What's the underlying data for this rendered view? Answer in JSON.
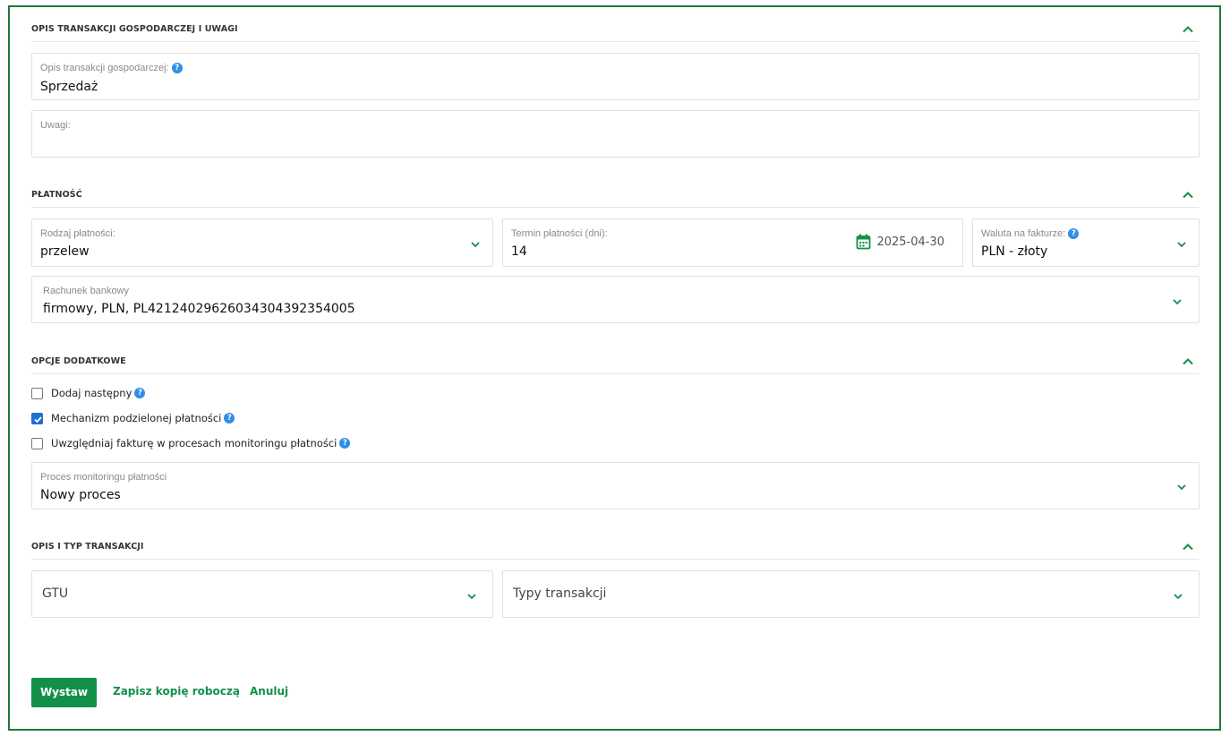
{
  "sections": {
    "transaction": {
      "title": "OPIS TRANSAKCJI GOSPODARCZEJ I UWAGI"
    },
    "payment": {
      "title": "PŁATNOŚĆ"
    },
    "options": {
      "title": "OPCJE DODATKOWE"
    },
    "type": {
      "title": "OPIS I TYP TRANSAKCJI"
    }
  },
  "fields": {
    "description": {
      "label": "Opis transakcji gospodarczej:",
      "value": "Sprzedaż"
    },
    "notes": {
      "label": "Uwagi:",
      "value": ""
    },
    "payment_type": {
      "label": "Rodzaj płatności:",
      "value": "przelew"
    },
    "payment_term": {
      "label": "Termin płatności (dni):",
      "value": "14",
      "date": "2025-04-30"
    },
    "currency": {
      "label": "Waluta na fakturze:",
      "value": "PLN - złoty"
    },
    "bank_account": {
      "label": "Rachunek bankowy",
      "value": "firmowy, PLN, PL42124029626034304392354005"
    },
    "monitoring_process": {
      "label": "Proces monitoringu płatności",
      "value": "Nowy proces"
    },
    "gtu": {
      "value": "GTU"
    },
    "transaction_types": {
      "value": "Typy transakcji"
    }
  },
  "options": [
    {
      "label": "Dodaj następny",
      "checked": false
    },
    {
      "label": "Mechanizm podzielonej płatności",
      "checked": true
    },
    {
      "label": "Uwzględniaj fakturę w procesach monitoringu płatności",
      "checked": false
    }
  ],
  "actions": {
    "issue": "Wystaw",
    "save_draft": "Zapisz kopię roboczą",
    "cancel": "Anuluj"
  },
  "colors": {
    "accent": "#12904a",
    "border": "#1e7a3c",
    "help": "#2f8fe6",
    "checkbox": "#1f6fd6"
  }
}
